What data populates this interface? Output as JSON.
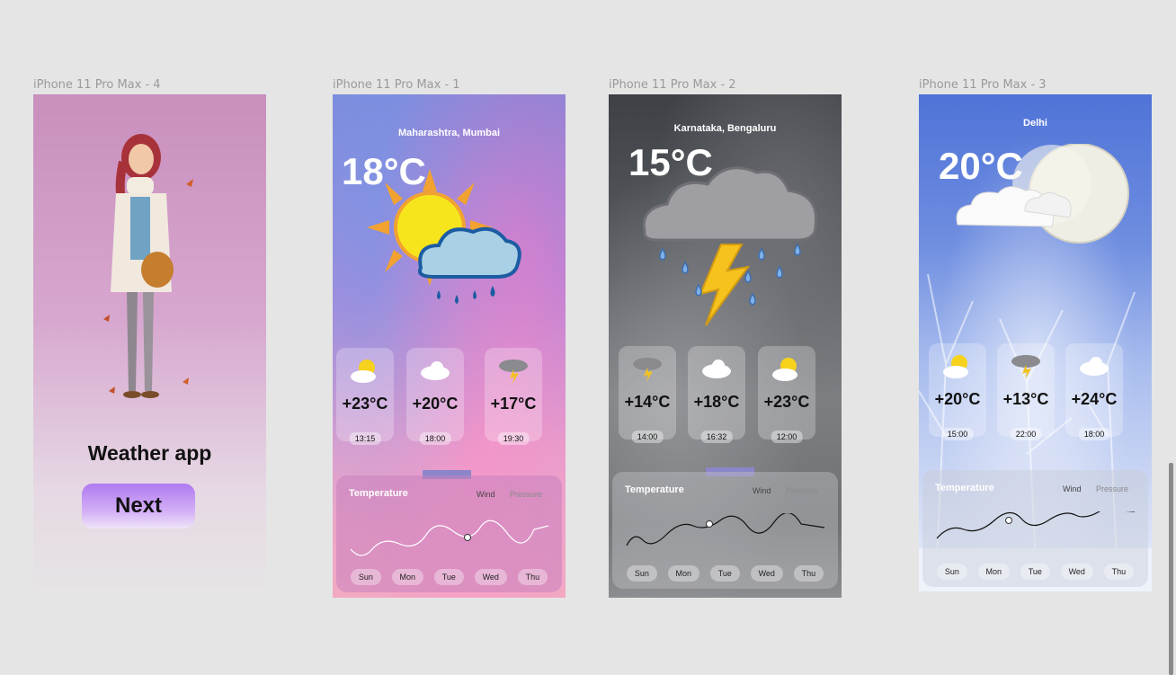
{
  "frames": {
    "f4": {
      "label": "iPhone 11 Pro Max - 4",
      "app_title": "Weather app",
      "next_label": "Next"
    },
    "f1": {
      "label": "iPhone 11 Pro Max - 1",
      "city": "Maharashtra, Mumbai",
      "temp": "18°C",
      "hours": [
        {
          "icon": "sun-cloud-icon",
          "temp": "+23°C",
          "time": "13:15"
        },
        {
          "icon": "cloud-icon",
          "temp": "+20°C",
          "time": "18:00"
        },
        {
          "icon": "thunder-cloud-icon",
          "temp": "+17°C",
          "time": "19:30"
        }
      ],
      "panel": {
        "title": "Temperature",
        "wind": "Wind",
        "pressure": "Pressure"
      },
      "days": [
        "Sun",
        "Mon",
        "Tue",
        "Wed",
        "Thu"
      ]
    },
    "f2": {
      "label": "iPhone 11 Pro Max - 2",
      "city": "Karnataka, Bengaluru",
      "temp": "15°C",
      "hours": [
        {
          "icon": "thunder-cloud-icon",
          "temp": "+14°C",
          "time": "14:00"
        },
        {
          "icon": "cloud-icon",
          "temp": "+18°C",
          "time": "16:32"
        },
        {
          "icon": "sun-cloud-icon",
          "temp": "+23°C",
          "time": "12:00"
        }
      ],
      "panel": {
        "title": "Temperature",
        "wind": "Wind",
        "pressure": "Pressure"
      },
      "days": [
        "Sun",
        "Mon",
        "Tue",
        "Wed",
        "Thu"
      ]
    },
    "f3": {
      "label": "iPhone 11 Pro Max - 3",
      "city": "Delhi",
      "temp": "20°C",
      "hours": [
        {
          "icon": "sun-cloud-icon",
          "temp": "+20°C",
          "time": "15:00"
        },
        {
          "icon": "thunder-cloud-icon",
          "temp": "+13°C",
          "time": "22:00"
        },
        {
          "icon": "cloud-icon",
          "temp": "+24°C",
          "time": "18:00"
        }
      ],
      "panel": {
        "title": "Temperature",
        "wind": "Wind",
        "pressure": "Pressure"
      },
      "days": [
        "Sun",
        "Mon",
        "Tue",
        "Wed",
        "Thu"
      ]
    }
  },
  "colors": {
    "canvas": "#e5e5e5",
    "accent": "#8b86c9",
    "button": "#b07af0"
  }
}
